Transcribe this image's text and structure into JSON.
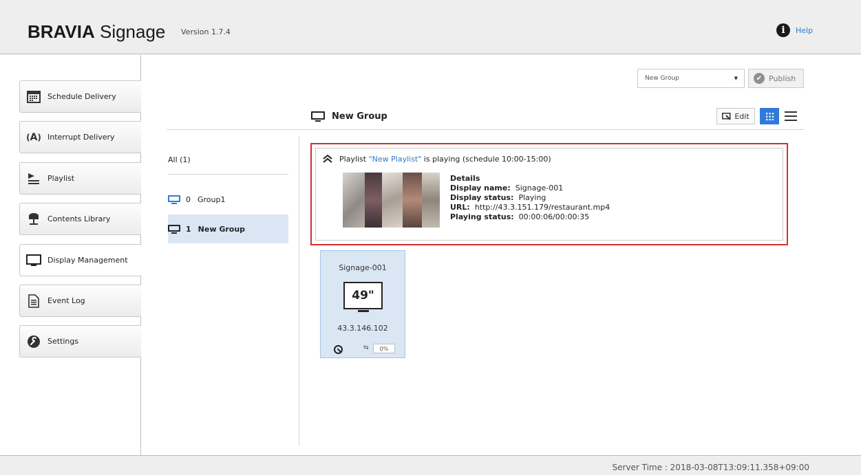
{
  "header": {
    "brand_bold": "BRAVIA",
    "brand_light": " Signage",
    "version": "Version 1.7.4",
    "help_label": "Help",
    "help_icon": "info-icon"
  },
  "sidebar": {
    "items": [
      {
        "label": "Schedule Delivery",
        "icon": "calendar-icon"
      },
      {
        "label": "Interrupt Delivery",
        "icon": "broadcast-icon"
      },
      {
        "label": "Playlist",
        "icon": "playlist-icon"
      },
      {
        "label": "Contents Library",
        "icon": "library-icon"
      },
      {
        "label": "Display Management",
        "icon": "monitor-icon",
        "active": true
      },
      {
        "label": "Event Log",
        "icon": "document-icon"
      },
      {
        "label": "Settings",
        "icon": "wrench-icon"
      }
    ]
  },
  "toolbar": {
    "group_select_value": "New Group",
    "publish_label": "Publish",
    "edit_label": "Edit"
  },
  "main": {
    "group_title": "New Group"
  },
  "groups": {
    "all_label": "All (1)",
    "items": [
      {
        "count": "0",
        "name": "Group1",
        "selected": false
      },
      {
        "count": "1",
        "name": "New Group",
        "selected": true
      }
    ]
  },
  "playing": {
    "prefix": "Playlist ",
    "playlist_name": "\"New Playlist\"",
    "suffix": " is playing (schedule 10:00-15:00)",
    "details_heading": "Details",
    "display_name_label": "Display name:",
    "display_name": "Signage-001",
    "display_status_label": "Display status:",
    "display_status": "Playing",
    "url_label": "URL:",
    "url": "http://43.3.151.179/restaurant.mp4",
    "playing_status_label": "Playing status:",
    "playing_status": "00:00:06/00:00:35"
  },
  "device": {
    "name": "Signage-001",
    "size": "49\"",
    "ip": "43.3.146.102",
    "progress": "0%"
  },
  "footer": {
    "server_time": "Server Time : 2018-03-08T13:09:11.358+09:00"
  },
  "colors": {
    "accent": "#2f7bd9",
    "highlight_border": "#d92c2c",
    "selected_bg": "#dbe6f4",
    "link": "#2b7bc6"
  }
}
